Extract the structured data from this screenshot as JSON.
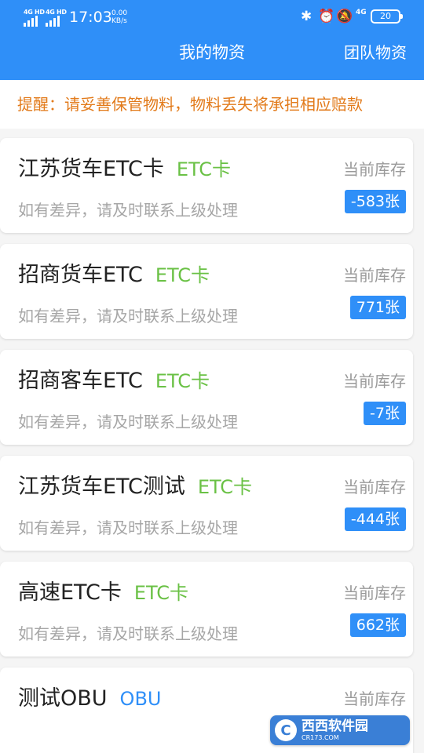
{
  "status_bar": {
    "sig1_label": "4G HD",
    "sig2_label": "4G HD",
    "time": "17:03",
    "net_speed_value": "0.00",
    "net_speed_unit": "KB/s",
    "bluetooth_icon": "bluetooth-icon",
    "alarm_icon": "alarm-clock-icon",
    "mute_icon": "notifications-off-icon",
    "lte_label": "4G",
    "battery": "20"
  },
  "header": {
    "title": "我的物资",
    "team_link": "团队物资",
    "background_color": "#2f8ff8"
  },
  "notice": {
    "text": "提醒：请妥善保管物料，物料丢失将承担相应赔款",
    "color": "#e27a1a"
  },
  "items": [
    {
      "name": "江苏货车ETC卡",
      "type": "ETC卡",
      "subtitle": "如有差异，请及时联系上级处理",
      "stock_label": "当前库存",
      "stock": "-583张"
    },
    {
      "name": "招商货车ETC",
      "type": "ETC卡",
      "subtitle": "如有差异，请及时联系上级处理",
      "stock_label": "当前库存",
      "stock": "771张"
    },
    {
      "name": "招商客车ETC",
      "type": "ETC卡",
      "subtitle": "如有差异，请及时联系上级处理",
      "stock_label": "当前库存",
      "stock": "-7张"
    },
    {
      "name": "江苏货车ETC测试",
      "type": "ETC卡",
      "subtitle": "如有差异，请及时联系上级处理",
      "stock_label": "当前库存",
      "stock": "-444张"
    },
    {
      "name": "高速ETC卡",
      "type": "ETC卡",
      "subtitle": "如有差异，请及时联系上级处理",
      "stock_label": "当前库存",
      "stock": "662张"
    },
    {
      "name": "测试OBU",
      "type": "OBU",
      "subtitle": "",
      "stock_label": "当前库存",
      "stock": ""
    }
  ],
  "type_colors": {
    "etc": "#6ac145",
    "obu": "#2f8ff8"
  },
  "watermark": {
    "main": "西西软件园",
    "sub": "CR173.COM"
  }
}
